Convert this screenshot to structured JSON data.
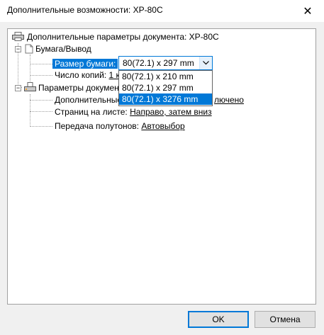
{
  "window": {
    "title": "Дополнительные возможности: XP-80C",
    "close_glyph": "✕"
  },
  "tree": {
    "root_label": "Дополнительные параметры документа: XP-80C",
    "paper_output": {
      "label": "Бумага/Вывод",
      "paper_size": {
        "label": "Размер бумаги:",
        "value": "80(72.1) x 297 mm",
        "options": [
          "80(72.1) x 210 mm",
          "80(72.1) x 297 mm",
          "80(72.1) x 3276 mm"
        ],
        "highlighted_index": 2
      },
      "copies": {
        "label": "Число копий:",
        "value": "1 к"
      }
    },
    "document_params": {
      "label": "Параметры докумен",
      "advanced": {
        "label": "Дополнительные",
        "value": "лючено"
      },
      "pages_per_sheet": {
        "label": "Страниц на листе:",
        "value": "Направо, затем вниз"
      },
      "halftone": {
        "label": "Передача полутонов:",
        "value": "Автовыбор"
      }
    }
  },
  "buttons": {
    "ok": "OK",
    "cancel": "Отмена"
  },
  "colors": {
    "accent": "#0078d7",
    "window_bg": "#f0f0f0"
  }
}
